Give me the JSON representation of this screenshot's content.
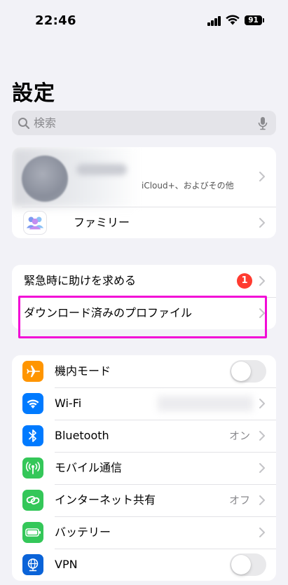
{
  "status_bar": {
    "time": "22:46",
    "battery": "91"
  },
  "page_title": "設定",
  "search": {
    "placeholder": "検索"
  },
  "account": {
    "subtitle": "iCloud+、およびその他"
  },
  "family": {
    "label": "ファミリー"
  },
  "group2": {
    "emergency_label": "緊急時に助けを求める",
    "emergency_badge": "1",
    "profile_label": "ダウンロード済みのプロファイル"
  },
  "settings": [
    {
      "label": "機内モード",
      "icon": "airplane-icon",
      "color": "#ff9500",
      "value": "",
      "toggle": "off"
    },
    {
      "label": "Wi-Fi",
      "icon": "wifi-icon",
      "color": "#007aff",
      "value": ""
    },
    {
      "label": "Bluetooth",
      "icon": "bluetooth-icon",
      "color": "#007aff",
      "value": "オン"
    },
    {
      "label": "モバイル通信",
      "icon": "antenna-icon",
      "color": "#34c759",
      "value": ""
    },
    {
      "label": "インターネット共有",
      "icon": "link-icon",
      "color": "#34c759",
      "value": "オフ"
    },
    {
      "label": "バッテリー",
      "icon": "battery-icon",
      "color": "#34c759",
      "value": ""
    },
    {
      "label": "VPN",
      "icon": "globe-icon",
      "color": "#0a63d8",
      "value": "",
      "toggle": "off"
    }
  ],
  "colors": {
    "highlight": "#f20bd6",
    "badge": "#ff3b30",
    "background": "#f2f2f7"
  }
}
